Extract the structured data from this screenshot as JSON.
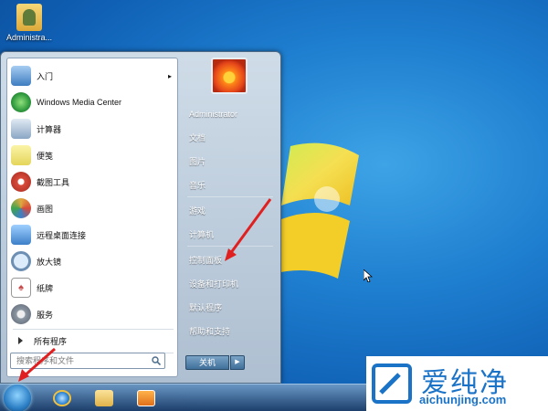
{
  "desktop": {
    "icon_label": "Administra..."
  },
  "start_menu": {
    "programs": [
      {
        "label": "入门",
        "has_submenu": true,
        "icon": "getting-started-icon",
        "color": "#6fa3d8"
      },
      {
        "label": "Windows Media Center",
        "has_submenu": false,
        "icon": "media-center-icon",
        "color": "#2f9a3e"
      },
      {
        "label": "计算器",
        "has_submenu": false,
        "icon": "calculator-icon",
        "color": "#8aa6c4"
      },
      {
        "label": "便笺",
        "has_submenu": false,
        "icon": "sticky-notes-icon",
        "color": "#e5d55a"
      },
      {
        "label": "截图工具",
        "has_submenu": false,
        "icon": "snipping-tool-icon",
        "color": "#d84a3a"
      },
      {
        "label": "画图",
        "has_submenu": false,
        "icon": "paint-icon",
        "color": "#e0a840"
      },
      {
        "label": "远程桌面连接",
        "has_submenu": false,
        "icon": "remote-desktop-icon",
        "color": "#3d7fc8"
      },
      {
        "label": "放大镜",
        "has_submenu": false,
        "icon": "magnifier-icon",
        "color": "#6c8fb3"
      },
      {
        "label": "纸牌",
        "has_submenu": false,
        "icon": "solitaire-icon",
        "color": "#c94b4b"
      },
      {
        "label": "服务",
        "has_submenu": false,
        "icon": "services-icon",
        "color": "#8b96a3"
      }
    ],
    "all_programs": "所有程序",
    "search_placeholder": "搜索程序和文件",
    "right_items": [
      "Administrator",
      "文档",
      "图片",
      "音乐",
      "游戏",
      "计算机",
      "控制面板",
      "设备和打印机",
      "默认程序",
      "帮助和支持"
    ],
    "shutdown_label": "关机",
    "shutdown_arrow": "▶"
  },
  "watermark": {
    "title": "爱纯净",
    "url": "aichunjing.com"
  },
  "colors": {
    "annotation_arrow": "#e02020",
    "watermark_blue": "#1a73c7"
  }
}
